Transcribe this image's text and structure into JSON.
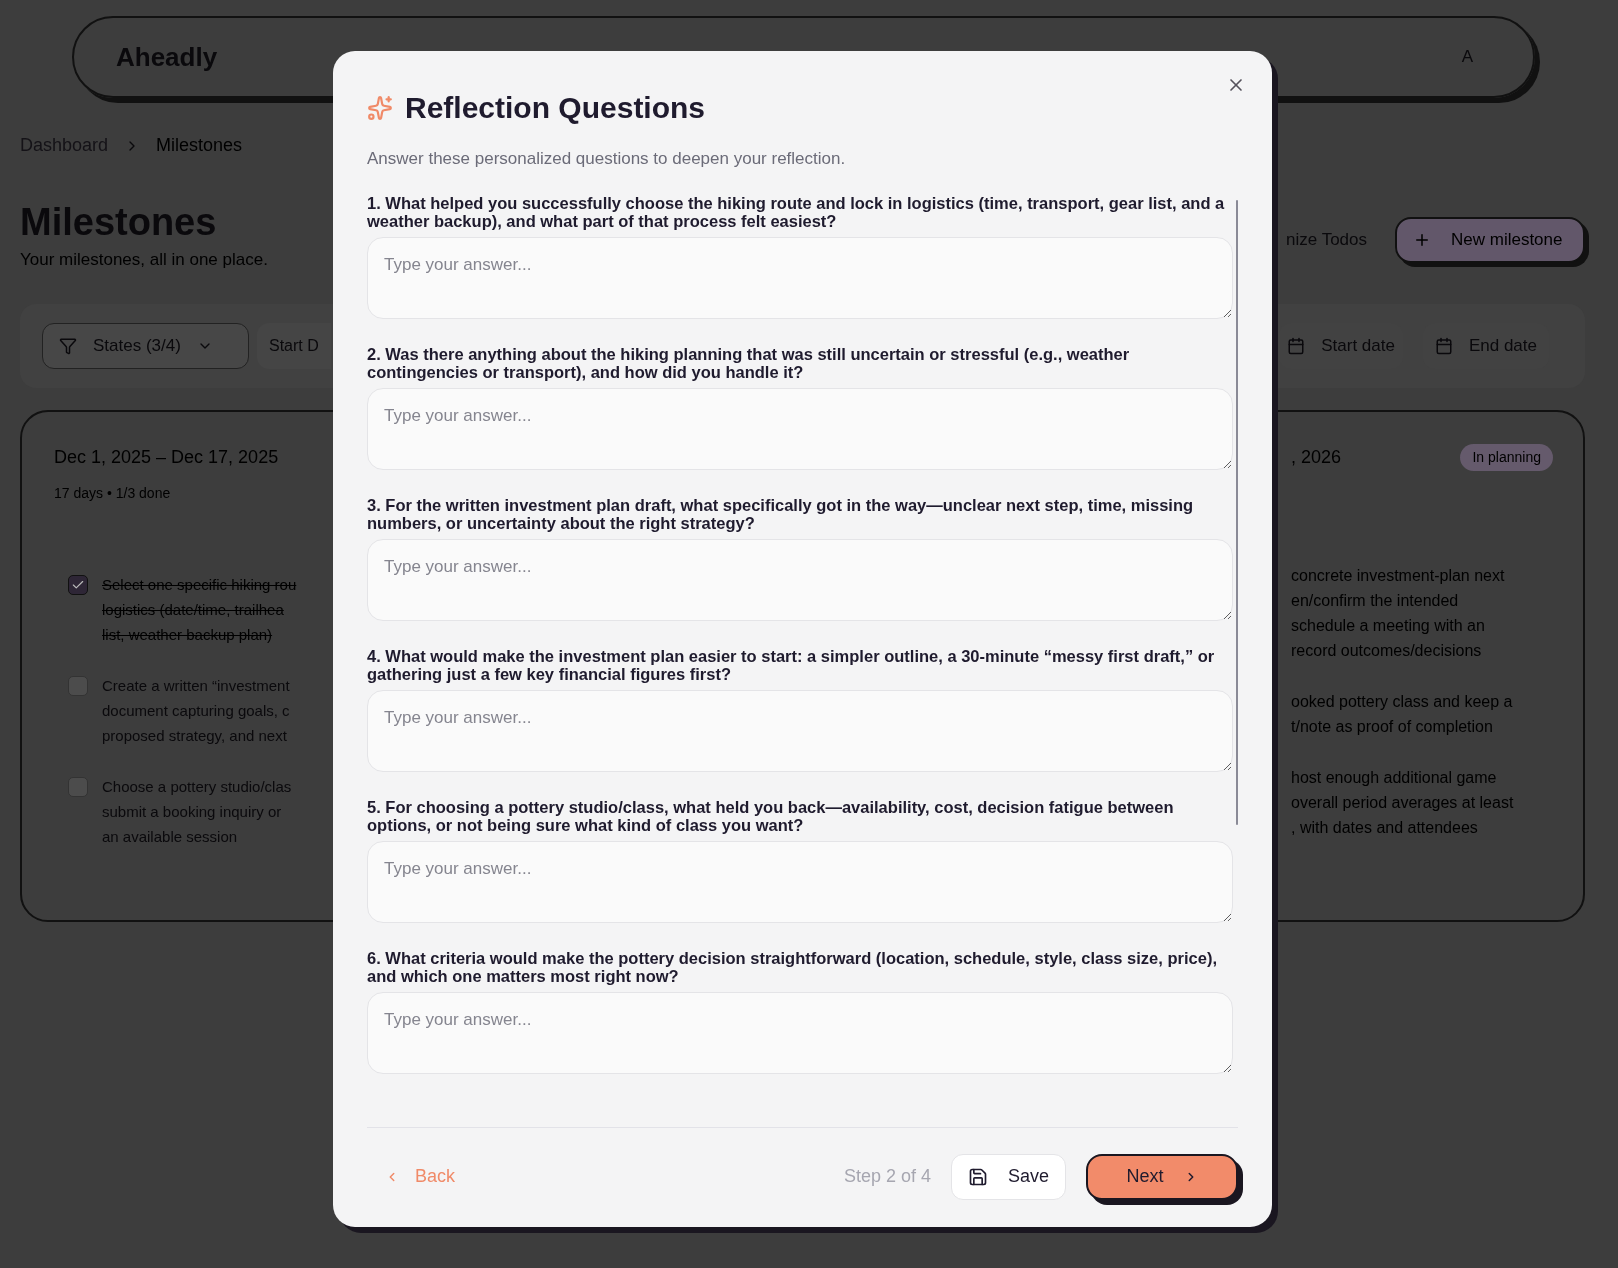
{
  "app": {
    "brand": "Aheadly",
    "avatar": "A"
  },
  "breadcrumb": [
    {
      "label": "Dashboard",
      "current": false
    },
    {
      "label": "Milestones",
      "current": true
    }
  ],
  "page": {
    "title": "Milestones",
    "subtitle": "Your milestones, all in one place.",
    "organize_fragment": "nize Todos",
    "new_button": "New milestone"
  },
  "filters": {
    "states": "States (3/4)",
    "start_fragment": "Start D",
    "start_date": "Start date",
    "end_date": "End date"
  },
  "cards": [
    {
      "date": "Dec 1, 2025 – Dec 17, 2025",
      "meta": "17 days • 1/3 done",
      "tasks": [
        {
          "checked": true,
          "lines": [
            "Select one specific hiking rou",
            "logistics (date/time, trailhea",
            "list, weather backup plan)"
          ]
        },
        {
          "checked": false,
          "lines": [
            "Create a written “investment",
            "document capturing goals, c",
            "proposed strategy, and next"
          ]
        },
        {
          "checked": false,
          "lines": [
            "Choose a pottery studio/clas",
            "submit a booking inquiry or",
            "an available session"
          ]
        }
      ]
    },
    {
      "date": ", 2026",
      "status": "In planning",
      "tasks": [
        {
          "lines": [
            "concrete investment-plan next",
            "en/confirm the intended",
            "schedule a meeting with an",
            "record outcomes/decisions"
          ]
        },
        {
          "lines": [
            "ooked pottery class and keep a",
            "t/note as proof of completion"
          ]
        },
        {
          "lines": [
            "host enough additional game",
            "overall period averages at least",
            ", with dates and attendees"
          ]
        }
      ]
    }
  ],
  "modal": {
    "title": "Reflection Questions",
    "description": "Answer these personalized questions to deepen your reflection.",
    "questions": [
      {
        "text": "1. What helped you successfully choose the hiking route and lock in logistics (time, transport, gear list, and a weather backup), and what part of that process felt easiest?",
        "placeholder": "Type your answer..."
      },
      {
        "text": "2. Was there anything about the hiking planning that was still uncertain or stressful (e.g., weather contingencies or transport), and how did you handle it?",
        "placeholder": "Type your answer..."
      },
      {
        "text": "3. For the written investment plan draft, what specifically got in the way—unclear next step, time, missing numbers, or uncertainty about the right strategy?",
        "placeholder": "Type your answer..."
      },
      {
        "text": "4. What would make the investment plan easier to start: a simpler outline, a 30-minute “messy first draft,” or gathering just a few key financial figures first?",
        "placeholder": "Type your answer..."
      },
      {
        "text": "5. For choosing a pottery studio/class, what held you back—availability, cost, decision fatigue between options, or not being sure what kind of class you want?",
        "placeholder": "Type your answer..."
      },
      {
        "text": "6. What criteria would make the pottery decision straightforward (location, schedule, style, class size, price), and which one matters most right now?",
        "placeholder": "Type your answer..."
      }
    ],
    "back": "Back",
    "step": "Step 2 of 4",
    "save": "Save",
    "next": "Next"
  }
}
